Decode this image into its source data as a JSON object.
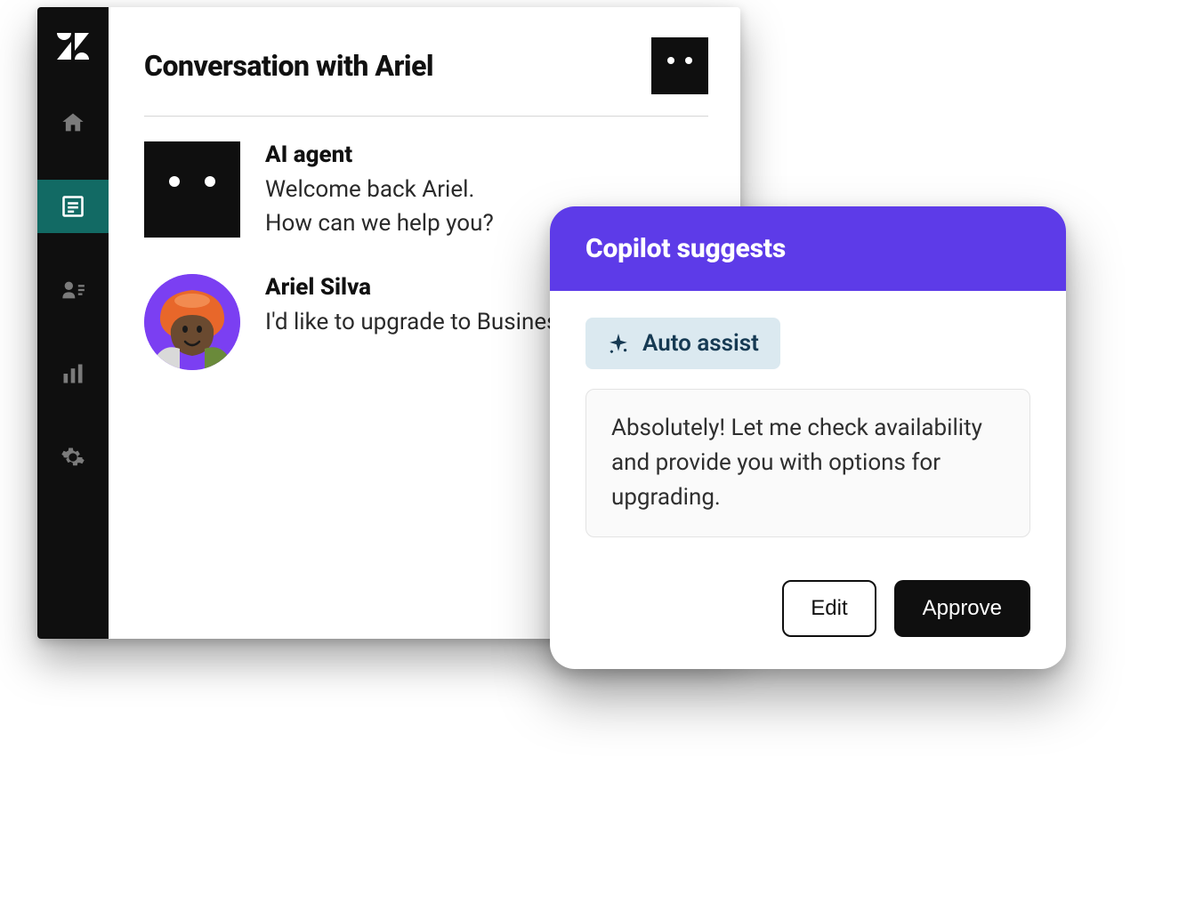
{
  "conversation": {
    "title": "Conversation with Ariel",
    "messages": [
      {
        "sender": "AI agent",
        "text": "Welcome back Ariel.\nHow can we help you?"
      },
      {
        "sender": "Ariel Silva",
        "text": "I'd like to upgrade to Business class."
      }
    ]
  },
  "copilot": {
    "header": "Copilot suggests",
    "assist_label": "Auto assist",
    "suggestion": "Absolutely! Let me check availability and provide you with options for upgrading.",
    "edit_label": "Edit",
    "approve_label": "Approve"
  },
  "sidebar": {
    "items": [
      "home",
      "inbox",
      "contacts",
      "analytics",
      "settings"
    ],
    "active_index": 1
  },
  "colors": {
    "sidebar_bg": "#0f0f0f",
    "sidebar_active": "#126a64",
    "copilot_header": "#5d3be8",
    "assist_pill_bg": "#dbe9f0",
    "assist_pill_fg": "#163a53",
    "avatar_bg": "#7b3ff2"
  }
}
